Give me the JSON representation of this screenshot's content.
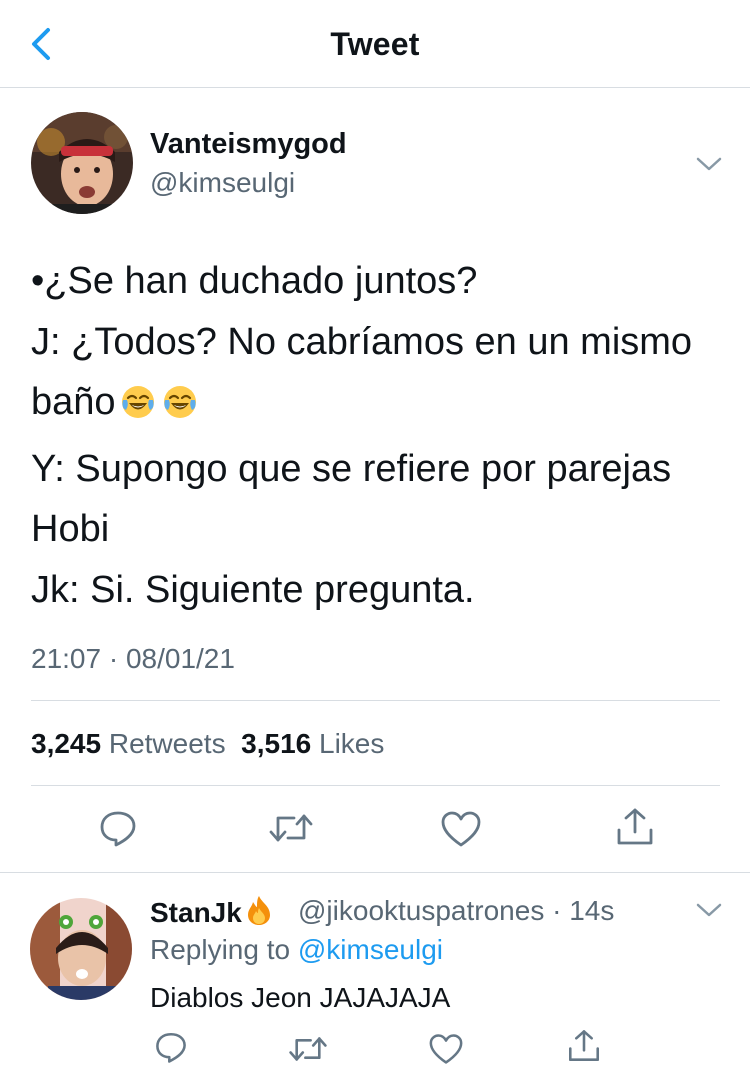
{
  "header": {
    "title": "Tweet",
    "back_icon": "chevron-left-icon",
    "accent_color": "#1d9bf0"
  },
  "tweet": {
    "author": {
      "display_name": "Vanteismygod",
      "handle": "@kimseulgi"
    },
    "lines": [
      "•¿Se han duchado juntos?",
      "J: ¿Todos? No cabríamos en un mismo",
      "baño",
      "Y: Supongo que se refiere por parejas",
      "Hobi",
      "Jk: Si. Siguiente pregunta."
    ],
    "emoji": "face-with-tears-of-joy",
    "timestamp": "21:07 · 08/01/21",
    "retweets_count": "3,245",
    "retweets_label": "Retweets",
    "likes_count": "3,516",
    "likes_label": "Likes"
  },
  "reply": {
    "author": {
      "display_name": "StanJk",
      "handle": "@jikooktuspatrones",
      "time": "14s"
    },
    "replying_to_prefix": "Replying to",
    "replying_to_handle": "@kimseulgi",
    "text": "Diablos Jeon JAJAJAJA"
  },
  "colors": {
    "text_primary": "#0f1419",
    "text_secondary": "#586774",
    "divider": "#d8dde2",
    "link": "#1d9bf0"
  }
}
